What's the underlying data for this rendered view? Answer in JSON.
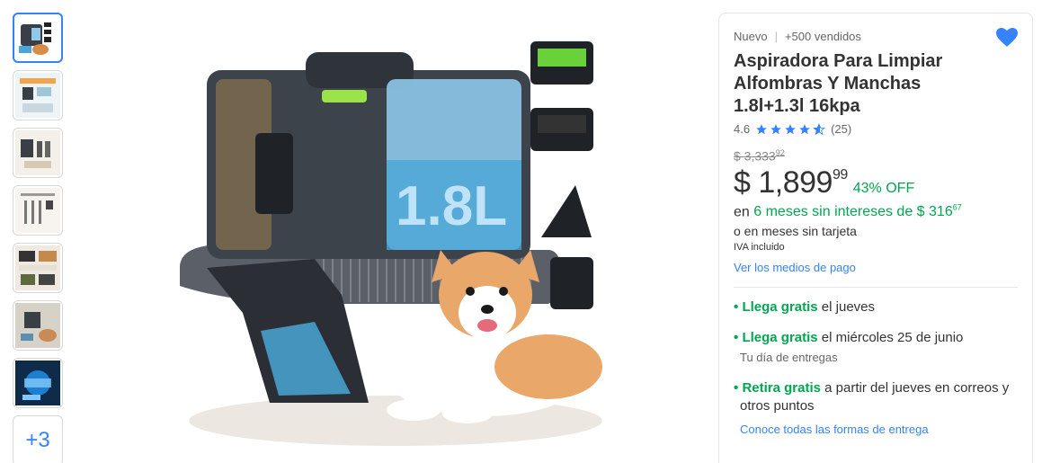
{
  "gallery": {
    "thumbnails": [
      "thumb-1",
      "thumb-2",
      "thumb-3",
      "thumb-4",
      "thumb-5",
      "thumb-6",
      "thumb-7"
    ],
    "more_label": "+3"
  },
  "product": {
    "condition": "Nuevo",
    "sold": "+500 vendidos",
    "title": "Aspiradora Para Limpiar Alfombras Y Manchas 1.8l+1.3l 16kpa",
    "rating_value": "4.6",
    "rating_stars": 4.6,
    "review_count": "(25)",
    "image_label": "1.8L"
  },
  "pricing": {
    "old_price_main": "$ 3,333",
    "old_price_cents": "92",
    "price_main": "$ 1,899",
    "price_cents": "99",
    "discount": "43% OFF",
    "installments_prefix": "en ",
    "installments_green": "6 meses sin intereses de $ 316",
    "installments_cents": "67",
    "alt_payment": "o en meses sin tarjeta",
    "tax_note": "IVA incluido",
    "payment_link": "Ver los medios de pago"
  },
  "shipping": [
    {
      "bullet": "•",
      "green": "Llega gratis",
      "rest": " el jueves",
      "sub": ""
    },
    {
      "bullet": "•",
      "green": "Llega gratis",
      "rest": " el miércoles 25 de junio",
      "sub": "Tu día de entregas"
    },
    {
      "bullet": "•",
      "green": "Retira gratis",
      "rest": " a partir del jueves en correos y",
      "sub2": "otros puntos"
    }
  ],
  "shipping_link": "Conoce todas las formas de entrega",
  "colors": {
    "accent": "#3483fa",
    "green": "#00a650"
  },
  "icons": {
    "favorite": "heart-icon",
    "star": "star-icon"
  }
}
